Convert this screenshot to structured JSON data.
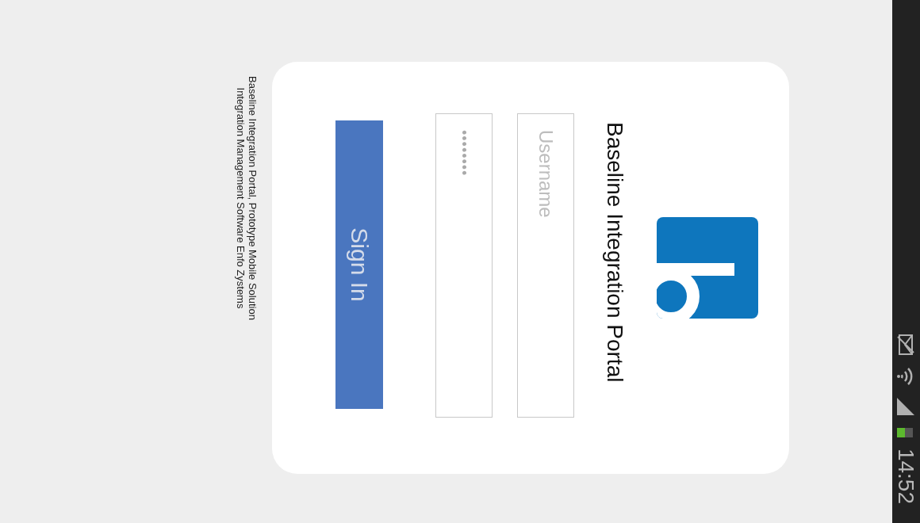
{
  "status_bar": {
    "time": "14:52"
  },
  "app": {
    "title": "Baseline Integration Portal"
  },
  "login_form": {
    "username": {
      "placeholder": "Username"
    },
    "password": {
      "value": "••••••••"
    },
    "sign_in_button": "Sign In"
  },
  "footer": [
    "Baseline Integration Portal, Prototype Mobile Solution",
    "Integration Management Software Enfo Zystems"
  ]
}
